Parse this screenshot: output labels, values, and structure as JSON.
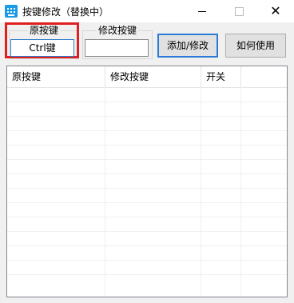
{
  "window": {
    "title": "按键修改（替换中）"
  },
  "form": {
    "original_key_label": "原按键",
    "original_key_value": "Ctrl键",
    "modified_key_label": "修改按键",
    "modified_key_value": "",
    "add_button": "添加/修改",
    "help_button": "如何使用"
  },
  "table": {
    "columns": [
      "原按键",
      "修改按键",
      "开关"
    ],
    "rows": []
  },
  "colors": {
    "highlight_border": "#e01f1f",
    "focus_blue": "#2b7bd6",
    "app_icon": "#1a9be6"
  }
}
